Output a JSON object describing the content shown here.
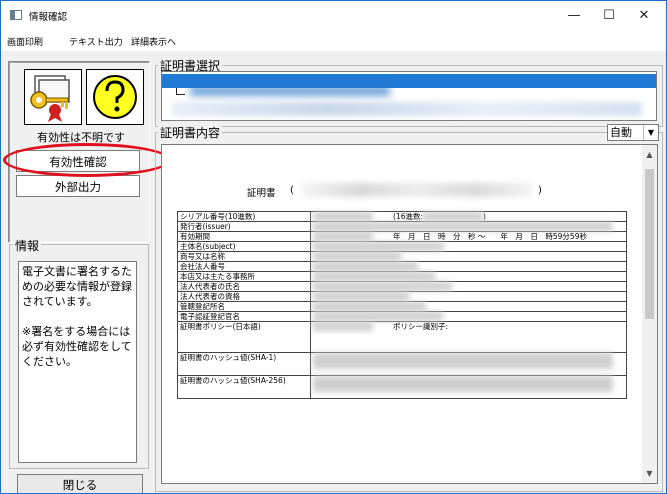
{
  "window": {
    "title": "情報確認",
    "minimize_glyph": "—",
    "maximize_glyph": "☐",
    "close_glyph": "✕"
  },
  "menu": [
    "画面印刷",
    "テキスト出力",
    "詳細表示へ"
  ],
  "left": {
    "validity_status": "有効性は不明です",
    "verify_button": "有効性確認",
    "export_button": "外部出力",
    "info_group_title": "情報",
    "info_text": "電子文書に署名するための必要な情報が登録されています。\n\n※署名をする場合には必ず有効性確認をしてください。",
    "close_button": "閉じる",
    "icons": [
      "certificate-keys-icon",
      "question-icon"
    ]
  },
  "cert_select": {
    "group_title": "証明書選択"
  },
  "cert_content": {
    "group_title": "証明書内容",
    "mode_select_value": "自動",
    "doc_title": "証明書",
    "paren_open": "(",
    "paren_close": ")",
    "rows": [
      {
        "label": "シリアル番号(10進数)",
        "value": "(16進数:",
        "value_suffix": ")"
      },
      {
        "label": "発行者(issuer)",
        "value": ""
      },
      {
        "label": "有効期間",
        "value": "年　月　日　時　分　秒 ～　　年　月　日　時59分59秒"
      },
      {
        "label": "主体名(subject)",
        "value": ""
      },
      {
        "label": "商号又は名称",
        "value": ""
      },
      {
        "label": "会社法人番号",
        "value": ""
      },
      {
        "label": "本店又は主たる事務所",
        "value": ""
      },
      {
        "label": "法人代表者の氏名",
        "value": ""
      },
      {
        "label": "法人代表者の資格",
        "value": ""
      },
      {
        "label": "管轄登記所名",
        "value": ""
      },
      {
        "label": "電子認証登記官名",
        "value": ""
      },
      {
        "label": "証明書ポリシー(日本語)",
        "value": "ポリシー識別子:"
      },
      {
        "label": "証明書のハッシュ値(SHA-1)",
        "value": ""
      },
      {
        "label": "証明書のハッシュ値(SHA-256)",
        "value": ""
      }
    ]
  },
  "colors": {
    "highlight_ring": "#e0101e",
    "selection_bar": "#1f7bd6",
    "window_border": "#1f6fc9"
  }
}
